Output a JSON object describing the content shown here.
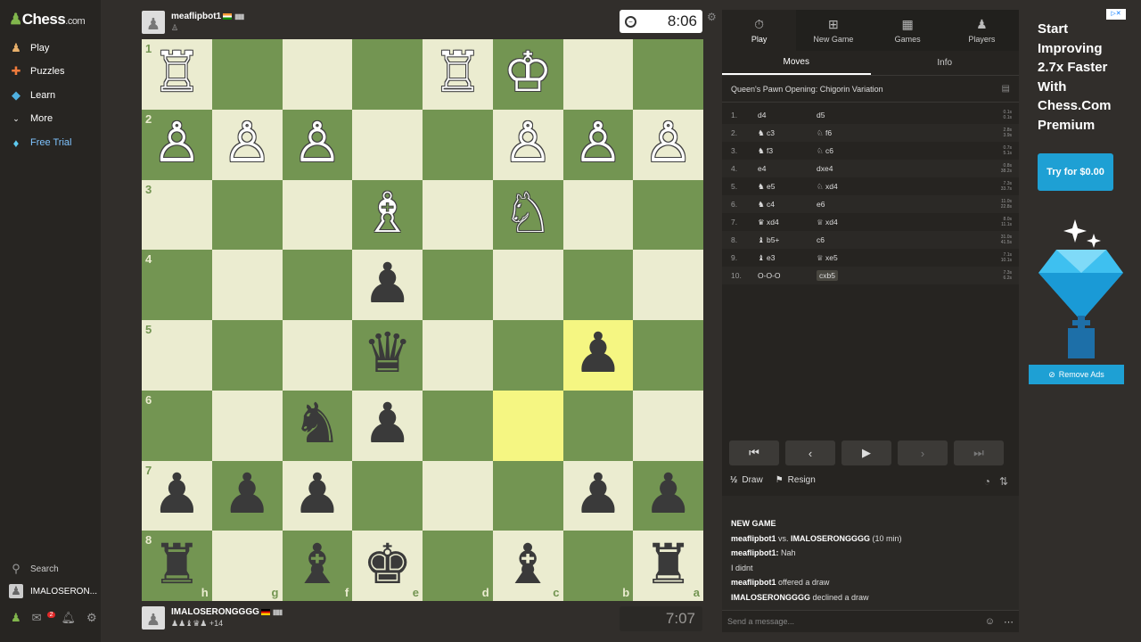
{
  "sidebar": {
    "logo": {
      "prefix": "♟",
      "name": "Chess",
      "suffix": ".com"
    },
    "nav": [
      {
        "label": "Play",
        "icon": "play-icon"
      },
      {
        "label": "Puzzles",
        "icon": "puzzle-icon"
      },
      {
        "label": "Learn",
        "icon": "learn-icon"
      },
      {
        "label": "More",
        "icon": "chevron-down-icon"
      },
      {
        "label": "Free Trial",
        "icon": "diamond-icon"
      }
    ],
    "search_label": "Search",
    "user_label": "IMALOSERON...",
    "mail_badge": "2"
  },
  "top_player": {
    "name": "meaflipbot1",
    "clock": "8:06"
  },
  "bottom_player": {
    "name": "IMALOSERONGGGG",
    "captured_extra": "+14",
    "clock": "7:07"
  },
  "board": {
    "ranks": [
      "1",
      "2",
      "3",
      "4",
      "5",
      "6",
      "7",
      "8"
    ],
    "files": [
      "h",
      "g",
      "f",
      "e",
      "d",
      "c",
      "b",
      "a"
    ],
    "highlight": [
      "c6",
      "b5"
    ],
    "rows": [
      [
        "wR",
        "",
        "",
        "",
        "wR",
        "wK",
        "",
        ""
      ],
      [
        "wP",
        "wP",
        "wP",
        "",
        "",
        "wP",
        "wP",
        "wP"
      ],
      [
        "",
        "",
        "",
        "wB",
        "",
        "wN",
        "",
        ""
      ],
      [
        "",
        "",
        "",
        "bP",
        "",
        "",
        "",
        ""
      ],
      [
        "",
        "",
        "",
        "bQ",
        "",
        "",
        "bP",
        ""
      ],
      [
        "",
        "",
        "bN",
        "bP",
        "",
        "",
        "",
        ""
      ],
      [
        "bP",
        "bP",
        "bP",
        "",
        "",
        "",
        "bP",
        "bP"
      ],
      [
        "bR",
        "",
        "bB",
        "bK",
        "",
        "bB",
        "",
        "bR"
      ]
    ]
  },
  "panel": {
    "tabs": [
      "Play",
      "New Game",
      "Games",
      "Players"
    ],
    "subtabs": [
      "Moves",
      "Info"
    ],
    "opening": "Queen's Pawn Opening: Chigorin Variation",
    "moves": [
      {
        "n": "1.",
        "w": "d4",
        "b": "d5",
        "tw": "0.1s",
        "tb": "0.1s"
      },
      {
        "n": "2.",
        "w": "♞ c3",
        "b": "♘ f6",
        "tw": "2.8s",
        "tb": "3.9s"
      },
      {
        "n": "3.",
        "w": "♞ f3",
        "b": "♘ c6",
        "tw": "0.7s",
        "tb": "5.1s"
      },
      {
        "n": "4.",
        "w": "e4",
        "b": "dxe4",
        "tw": "0.8s",
        "tb": "38.2s"
      },
      {
        "n": "5.",
        "w": "♞ e5",
        "b": "♘ xd4",
        "tw": "7.3s",
        "tb": "33.7s"
      },
      {
        "n": "6.",
        "w": "♞ c4",
        "b": "e6",
        "tw": "11.0s",
        "tb": "22.8s"
      },
      {
        "n": "7.",
        "w": "♛ xd4",
        "b": "♕ xd4",
        "tw": "8.0s",
        "tb": "11.1s"
      },
      {
        "n": "8.",
        "w": "♝ b5+",
        "b": "c6",
        "tw": "31.0s",
        "tb": "41.5s"
      },
      {
        "n": "9.",
        "w": "♝ e3",
        "b": "♕ xe5",
        "tw": "7.1s",
        "tb": "10.1s"
      },
      {
        "n": "10.",
        "w": "O-O-O",
        "b": "cxb5",
        "tw": "7.3s",
        "tb": "6.2s"
      }
    ],
    "draw_label": "Draw",
    "resign_label": "Resign",
    "chat": {
      "title": "NEW GAME",
      "line1_a": "meaflipbot1",
      "line1_b": " vs. ",
      "line1_c": "IMALOSERONGGGG",
      "line1_d": " (10 min)",
      "line2_a": "meaflipbot1:",
      "line2_b": " Nah",
      "line3": "I didnt",
      "line4_a": "meaflipbot1",
      "line4_b": " offered a draw",
      "line5_a": "IMALOSERONGGGG",
      "line5_b": " declined a draw",
      "placeholder": "Send a message..."
    }
  },
  "ad": {
    "headline": "Start Improving 2.7x Faster With Chess.Com Premium",
    "button": "Try for $0.00",
    "remove": "Remove Ads"
  },
  "colors": {
    "light_square": "#ebecd0",
    "dark_square": "#739552",
    "highlight": "#f5f682",
    "accent": "#1ea0d4"
  }
}
